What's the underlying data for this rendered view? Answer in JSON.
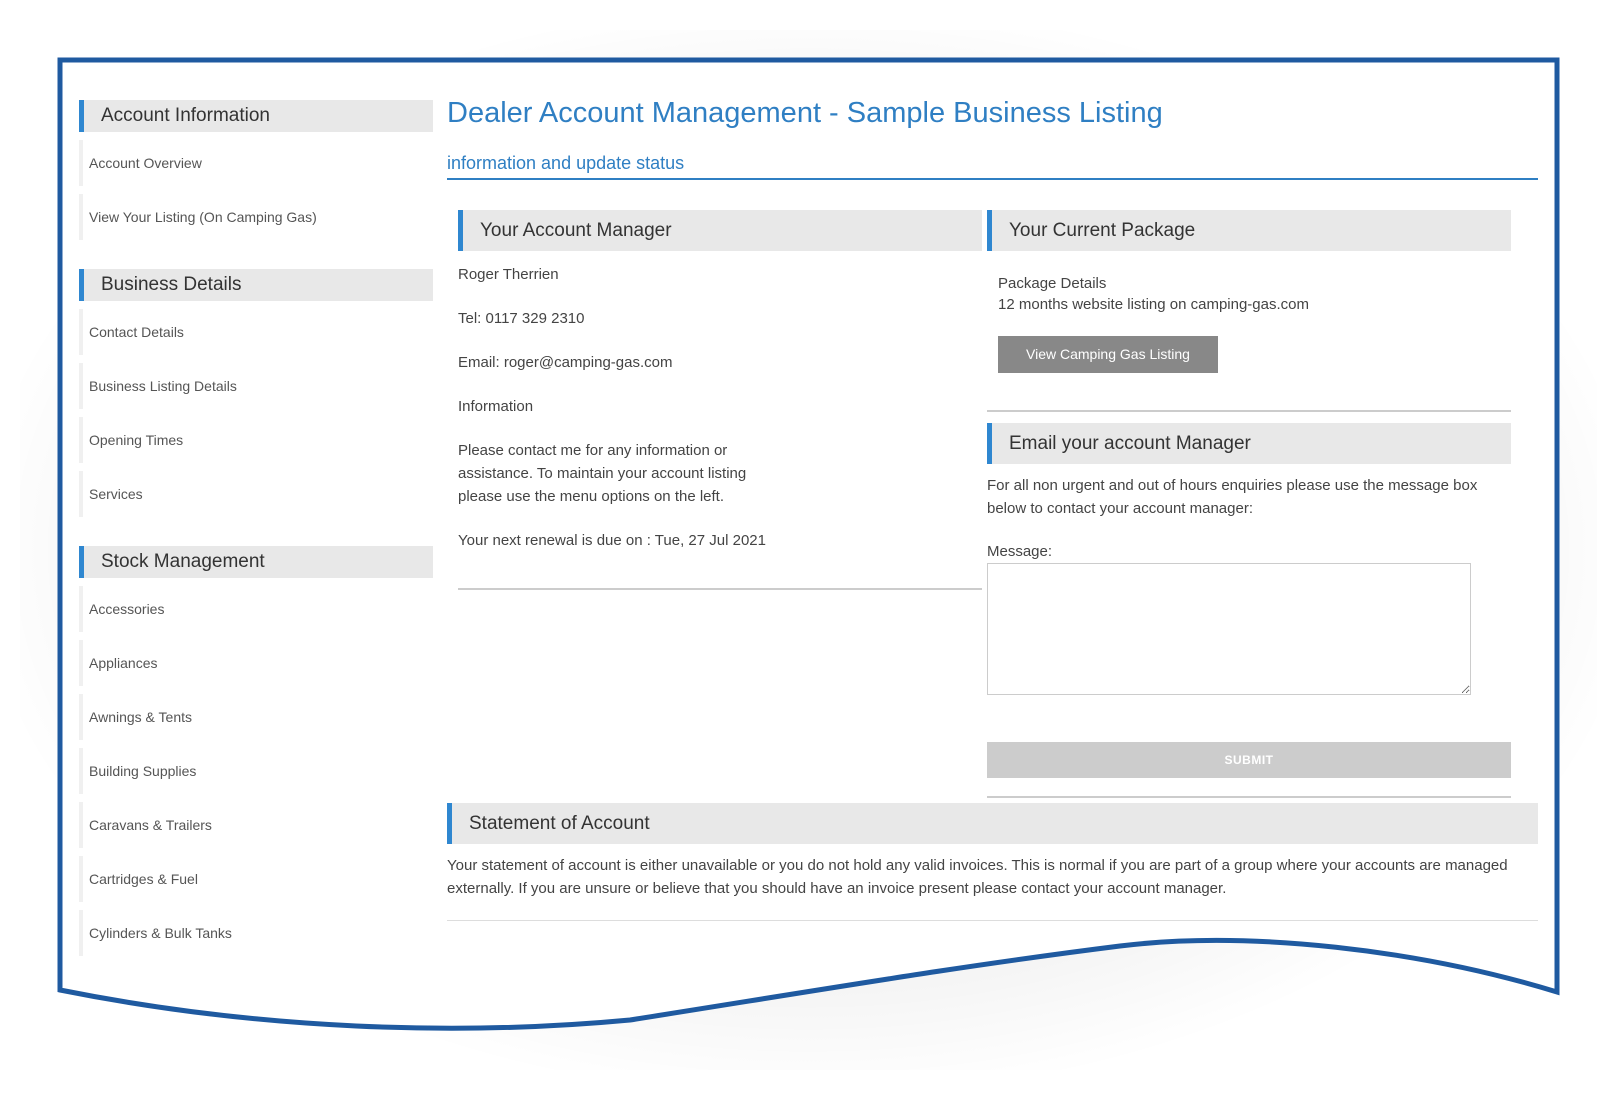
{
  "colors": {
    "accent": "#2f87d0",
    "title_blue": "#2f7fc3",
    "frame_blue": "#1f5aa0"
  },
  "sidebar": {
    "groups": [
      {
        "title": "Account Information",
        "items": [
          "Account Overview",
          "View Your Listing (On Camping Gas)"
        ]
      },
      {
        "title": "Business Details",
        "items": [
          "Contact Details",
          "Business Listing Details",
          "Opening Times",
          "Services"
        ]
      },
      {
        "title": "Stock Management",
        "items": [
          "Accessories",
          "Appliances",
          "Awnings & Tents",
          "Building Supplies",
          "Caravans & Trailers",
          "Cartridges & Fuel",
          "Cylinders & Bulk Tanks"
        ]
      }
    ]
  },
  "main": {
    "title": "Dealer Account Management - Sample Business Listing",
    "subtitle": "information and update status",
    "account_manager": {
      "heading": "Your Account Manager",
      "name": "Roger Therrien",
      "tel": "Tel: 0117 329 2310",
      "email": "Email: roger@camping-gas.com",
      "info_label": "Information",
      "info_text": "Please contact me for any information or assistance. To maintain your account listing please use the menu options on the left.",
      "renewal": "Your next renewal is due on : Tue, 27 Jul 2021"
    },
    "package": {
      "heading": "Your Current Package",
      "details_label": "Package Details",
      "details_text": "12 months website listing on camping-gas.com",
      "button": "View Camping Gas Listing"
    },
    "email_manager": {
      "heading": "Email your account Manager",
      "intro": "For all non urgent and out of hours enquiries please use the message box below to contact your account manager:",
      "message_label": "Message:",
      "message_value": "",
      "submit": "SUBMIT"
    },
    "statement": {
      "heading": "Statement of Account",
      "text": "Your statement of account is either unavailable or you do not hold any valid invoices. This is normal if you are part of a group where your accounts are managed externally. If you are unsure or believe that you should have an invoice present please contact your account manager."
    }
  }
}
